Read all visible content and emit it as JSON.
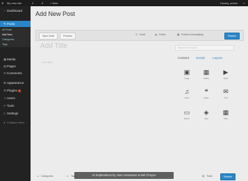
{
  "adminbar": {
    "site_name": "My new site",
    "comments": "2",
    "updates": "0",
    "new": "+ New",
    "greeting": "Howdy, admin"
  },
  "sidebar": {
    "items": [
      {
        "label": "Dashboard",
        "icon": "gauge-icon",
        "glyph": "◔"
      },
      {
        "label": "Posts",
        "icon": "pin-icon",
        "glyph": "✎"
      },
      {
        "label": "Media",
        "icon": "media-icon",
        "glyph": "▣"
      },
      {
        "label": "Pages",
        "icon": "page-icon",
        "glyph": "▤"
      },
      {
        "label": "Comments",
        "icon": "comment-icon",
        "glyph": "✉"
      },
      {
        "label": "Appearance",
        "icon": "brush-icon",
        "glyph": "✿"
      },
      {
        "label": "Plugins",
        "icon": "plug-icon",
        "glyph": "⚙"
      },
      {
        "label": "Users",
        "icon": "user-icon",
        "glyph": "☺"
      },
      {
        "label": "Tools",
        "icon": "wrench-icon",
        "glyph": "✂"
      },
      {
        "label": "Settings",
        "icon": "settings-icon",
        "glyph": "≡"
      },
      {
        "label": "Collapse menu",
        "icon": "collapse-icon",
        "glyph": "◂"
      }
    ],
    "submenu": [
      "All Posts",
      "Add New",
      "Categories",
      "Tags"
    ]
  },
  "page_title": "Add New Post",
  "toolbar": {
    "save_draft": "Save Draft",
    "preview": "Preview",
    "status": "Draft",
    "visibility": "Public",
    "schedule": "Publish immediately",
    "publish": "Publish"
  },
  "editor": {
    "title_placeholder": "Add Title",
    "body_placeholder": "Just write...",
    "search_placeholder": "Search for a block"
  },
  "panel": {
    "tabs": [
      "Content",
      "Social",
      "Layout"
    ],
    "blocks": [
      {
        "label": "Image",
        "icon": "image-icon",
        "glyph": "▣"
      },
      {
        "label": "Gallery",
        "icon": "gallery-icon",
        "glyph": "▦"
      },
      {
        "label": "Video",
        "icon": "video-icon",
        "glyph": "▶"
      },
      {
        "label": "Audio",
        "icon": "audio-icon",
        "glyph": "♫"
      },
      {
        "label": "Quote",
        "icon": "quote-icon",
        "glyph": "❝"
      },
      {
        "label": "Chat",
        "icon": "chat-icon",
        "glyph": "✉"
      },
      {
        "label": "Button",
        "icon": "button-icon",
        "glyph": "▭"
      },
      {
        "label": "Map",
        "icon": "map-icon",
        "glyph": "◈"
      },
      {
        "label": "Table",
        "icon": "table-icon",
        "glyph": "▦"
      }
    ]
  },
  "footer": {
    "categories": "Categories",
    "tags": "Tags",
    "trash": "Trash",
    "publish": "Publish"
  },
  "caption": "UI Explorations by Joen Asmussen & Mel Choyce",
  "colors": {
    "accent": "#2a86c8",
    "sidebar": "#222222",
    "canvas": "#ececec"
  }
}
